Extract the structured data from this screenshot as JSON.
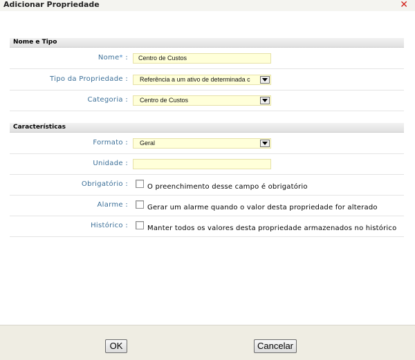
{
  "dialog": {
    "title": "Adicionar Propriedade",
    "close_symbol": "✕"
  },
  "sections": {
    "nome_tipo": {
      "title": "Nome e Tipo"
    },
    "caracteristicas": {
      "title": "Características"
    }
  },
  "fields": {
    "nome": {
      "label": "Nome",
      "required_mark": "*",
      "separator": ":",
      "value": "Centro de Custos"
    },
    "tipo": {
      "label": "Tipo da Propriedade :",
      "value": "Referência a um ativo de determinada c"
    },
    "categoria": {
      "label": "Categoria :",
      "value": "Centro de Custos"
    },
    "formato": {
      "label": "Formato :",
      "value": "Geral"
    },
    "unidade": {
      "label": "Unidade :",
      "value": ""
    },
    "obrigatorio": {
      "label": "Obrigatório :",
      "checkbox_text": "O preenchimento desse campo é obrigatório",
      "checked": false
    },
    "alarme": {
      "label": "Alarme :",
      "checkbox_text": "Gerar um alarme quando o valor desta propriedade for alterado",
      "checked": false
    },
    "historico": {
      "label": "Histórico :",
      "checkbox_text": "Manter todos os valores desta propriedade armazenados no histórico",
      "checked": false
    }
  },
  "buttons": {
    "ok": "OK",
    "cancel": "Cancelar"
  },
  "colors": {
    "label": "#3b6f98",
    "field_bg": "#ffffd9",
    "close": "#d1221b",
    "footer_bg": "#efede3"
  }
}
